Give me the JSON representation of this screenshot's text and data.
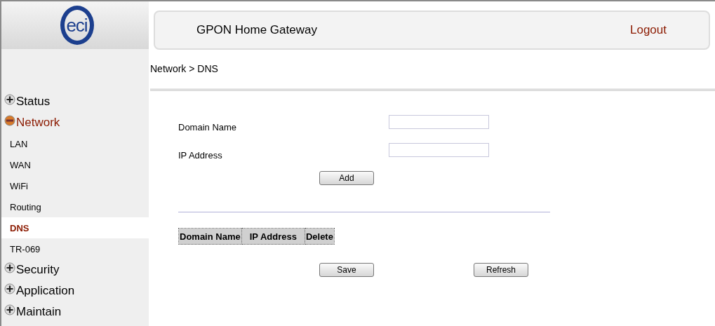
{
  "logo": "eci",
  "header": {
    "title": "GPON Home Gateway",
    "logout": "Logout"
  },
  "breadcrumb": "Network > DNS",
  "sidebar": {
    "items": [
      {
        "label": "Status",
        "expanded": false
      },
      {
        "label": "Network",
        "expanded": true,
        "children": [
          {
            "label": "LAN",
            "selected": false
          },
          {
            "label": "WAN",
            "selected": false
          },
          {
            "label": "WiFi",
            "selected": false
          },
          {
            "label": "Routing",
            "selected": false
          },
          {
            "label": "DNS",
            "selected": true
          },
          {
            "label": "TR-069",
            "selected": false
          }
        ]
      },
      {
        "label": "Security",
        "expanded": false
      },
      {
        "label": "Application",
        "expanded": false
      },
      {
        "label": "Maintain",
        "expanded": false
      }
    ]
  },
  "form": {
    "fields": [
      {
        "label": "Domain Name"
      },
      {
        "label": "IP Address"
      }
    ],
    "add_button": "Add"
  },
  "table": {
    "columns": [
      "Domain Name",
      "IP Address",
      "Delete"
    ]
  },
  "buttons": [
    "Save",
    "Refresh"
  ]
}
